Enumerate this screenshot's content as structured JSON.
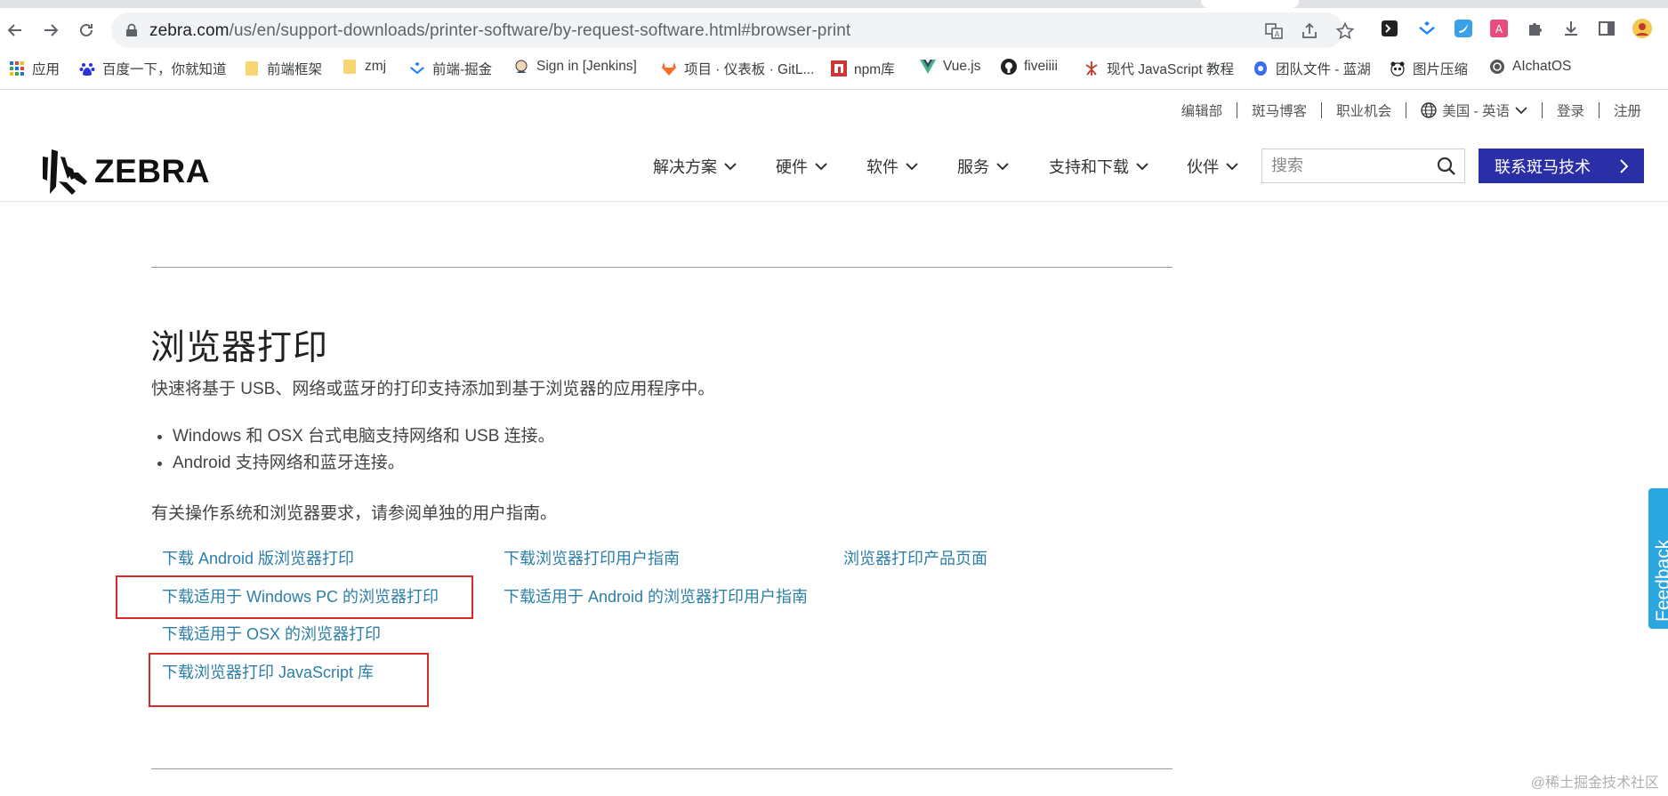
{
  "browser": {
    "url_domain": "zebra.com",
    "url_path": "/us/en/support-downloads/printer-software/by-request-software.html#browser-print"
  },
  "bookmarks": [
    {
      "label": "应用",
      "icon": "apps-grid-icon"
    },
    {
      "label": "百度一下，你就知道",
      "icon": "baidu-paw-icon"
    },
    {
      "label": "前端框架",
      "icon": "folder-icon"
    },
    {
      "label": "zmj",
      "icon": "folder-icon"
    },
    {
      "label": "前端-掘金",
      "icon": "juejin-icon"
    },
    {
      "label": "Sign in [Jenkins]",
      "icon": "jenkins-icon"
    },
    {
      "label": "项目 · 仪表板 · GitL...",
      "icon": "gitlab-icon"
    },
    {
      "label": "npm库",
      "icon": "npm-icon"
    },
    {
      "label": "Vue.js",
      "icon": "vue-icon"
    },
    {
      "label": "fiveiiii",
      "icon": "github-icon"
    },
    {
      "label": "现代 JavaScript 教程",
      "icon": "javascript-info-icon"
    },
    {
      "label": "团队文件 - 蓝湖",
      "icon": "lanhu-icon"
    },
    {
      "label": "图片压缩",
      "icon": "panda-icon"
    },
    {
      "label": "AIchatOS",
      "icon": "openai-icon"
    }
  ],
  "utility": {
    "editorial": "编辑部",
    "blog": "斑马博客",
    "careers": "职业机会",
    "region": "美国 - 英语",
    "login": "登录",
    "register": "注册"
  },
  "nav": {
    "solutions": "解决方案",
    "hardware": "硬件",
    "software": "软件",
    "services": "服务",
    "support": "支持和下载",
    "partners": "伙伴",
    "search_placeholder": "搜索",
    "contact": "联系斑马技术"
  },
  "logo": {
    "text": "ZEBRA"
  },
  "content": {
    "title": "浏览器打印",
    "intro": "快速将基于 USB、网络或蓝牙的打印支持添加到基于浏览器的应用程序中。",
    "bullets": [
      "Windows 和 OSX 台式电脑支持网络和 USB 连接。",
      "Android 支持网络和蓝牙连接。"
    ],
    "requirements": "有关操作系统和浏览器要求，请参阅单独的用户指南。",
    "links": {
      "android": "下载 Android 版浏览器打印",
      "windows": "下载适用于 Windows PC 的浏览器打印",
      "osx": "下载适用于 OSX 的浏览器打印",
      "js": "下载浏览器打印 JavaScript 库",
      "guide": "下载浏览器打印用户指南",
      "android_guide": "下载适用于 Android 的浏览器打印用户指南",
      "product": "浏览器打印产品页面"
    }
  },
  "feedback": "Feedback",
  "watermark": "@稀土掘金技术社区",
  "colors": {
    "brand_blue": "#2a2fa8",
    "link": "#2e7fa8",
    "highlight": "#d92a2a",
    "feedback": "#2aa6e0"
  }
}
